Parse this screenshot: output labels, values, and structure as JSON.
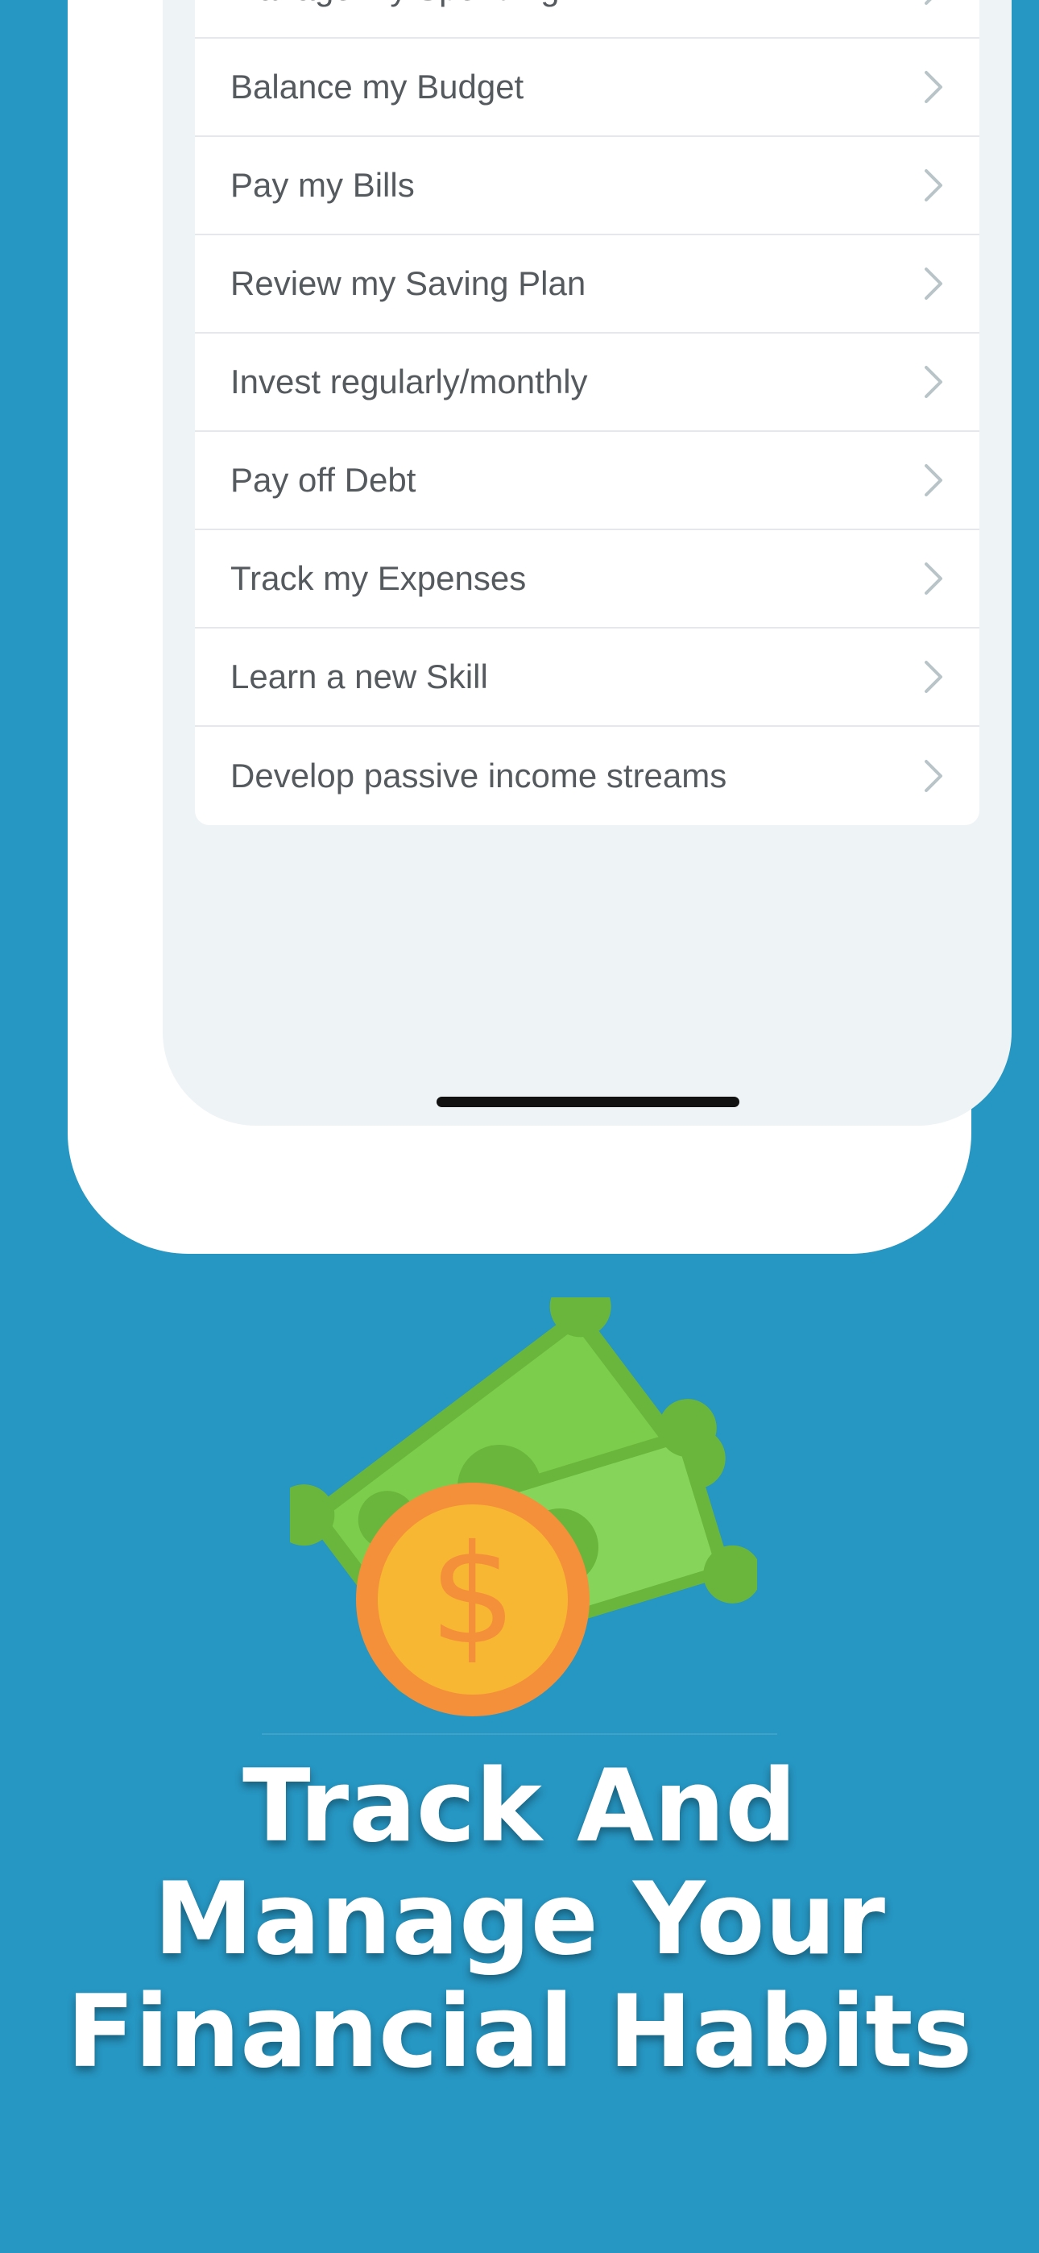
{
  "menu": {
    "items": [
      {
        "label": "Manage my Spending"
      },
      {
        "label": "Balance my Budget"
      },
      {
        "label": "Pay my Bills"
      },
      {
        "label": "Review my Saving Plan"
      },
      {
        "label": "Invest regularly/monthly"
      },
      {
        "label": "Pay off Debt"
      },
      {
        "label": "Track my Expenses"
      },
      {
        "label": "Learn a new Skill"
      },
      {
        "label": "Develop passive income streams"
      }
    ]
  },
  "headline": {
    "line1": "Track And",
    "line2": "Manage Your",
    "line3": "Financial Habits"
  },
  "colors": {
    "background": "#2696c2",
    "screen": "#eef3f5",
    "bill_green": "#7ccd4c",
    "coin_orange": "#f7b733"
  },
  "icons": {
    "chevron": "chevron-right-icon",
    "illustration": "money-bills-coin-icon"
  }
}
